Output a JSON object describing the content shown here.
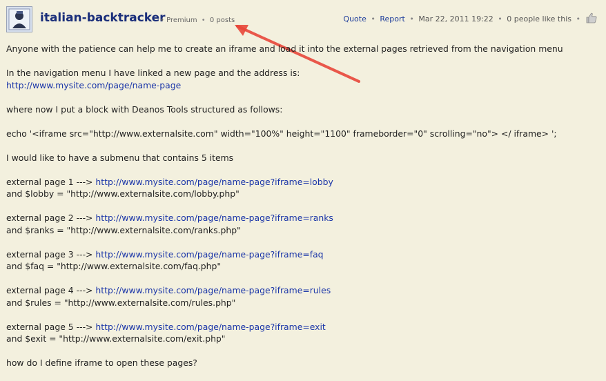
{
  "header": {
    "username": "italian-backtracker",
    "rank": "Premium",
    "post_count": "0 posts",
    "meta_separator": "•",
    "actions": {
      "quote": "Quote",
      "report": "Report",
      "date": "Mar 22, 2011 19:22",
      "likes": "0 people like this"
    },
    "icons": {
      "avatar": "user-avatar",
      "like": "thumbs-up-icon"
    }
  },
  "annotation": {
    "arrow_color": "#e8473a"
  },
  "post": {
    "intro": "Anyone with the patience can help me to create an iframe and load it into the external pages retrieved from the navigation menu",
    "nav_text": "In the navigation menu I have linked a new page and the address is:",
    "nav_link": "http://www.mysite.com/page/name-page",
    "block_text": "where now I put a block with Deanos Tools structured as follows:",
    "code_line": "echo '<iframe src=\"http://www.externalsite.com\" width=\"100%\" height=\"1100\" frameborder=\"0\" scrolling=\"no\"> </ iframe> ';",
    "submenu_text": "I would like to have a submenu that contains 5 items",
    "items": [
      {
        "label": "external page 1 ---> ",
        "link": "http://www.mysite.com/page/name-page?iframe=lobby",
        "var_line": "and $lobby = \"http://www.externalsite.com/lobby.php\""
      },
      {
        "label": "external page 2 ---> ",
        "link": "http://www.mysite.com/page/name-page?iframe=ranks",
        "var_line": "and $ranks = \"http://www.externalsite.com/ranks.php\""
      },
      {
        "label": "external page 3 ---> ",
        "link": "http://www.mysite.com/page/name-page?iframe=faq",
        "var_line": "and $faq = \"http://www.externalsite.com/faq.php\""
      },
      {
        "label": "external page 4 ---> ",
        "link": "http://www.mysite.com/page/name-page?iframe=rules",
        "var_line": "and $rules = \"http://www.externalsite.com/rules.php\""
      },
      {
        "label": "external page 5 ---> ",
        "link": "http://www.mysite.com/page/name-page?iframe=exit",
        "var_line": "and $exit = \"http://www.externalsite.com/exit.php\""
      }
    ],
    "question": "how do I define iframe to open these pages?"
  },
  "colors": {
    "background": "#f3f0de",
    "username": "#1a2e7a",
    "link": "#1a35a8"
  }
}
